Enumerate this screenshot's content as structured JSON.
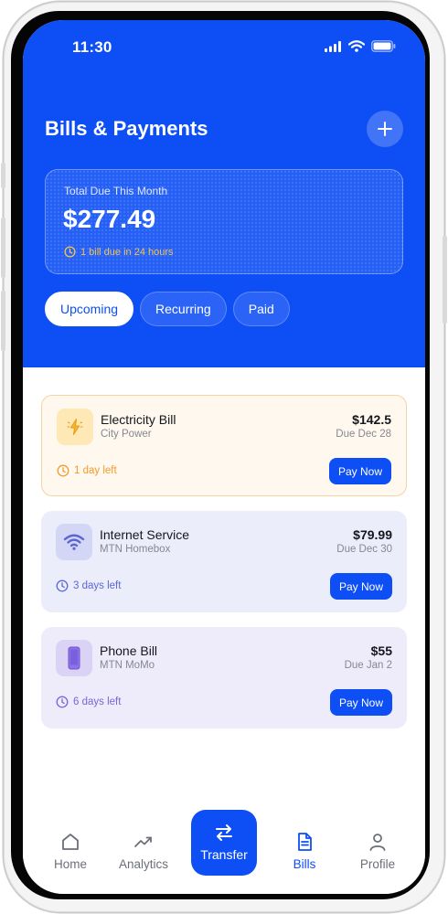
{
  "status_bar": {
    "time": "11:30"
  },
  "header": {
    "title": "Bills & Payments"
  },
  "summary": {
    "label": "Total Due This Month",
    "amount": "$277.49",
    "note": "1 bill due in 24 hours"
  },
  "tabs": [
    {
      "label": "Upcoming",
      "active": true
    },
    {
      "label": "Recurring",
      "active": false
    },
    {
      "label": "Paid",
      "active": false
    }
  ],
  "bills": [
    {
      "name": "Electricity Bill",
      "provider": "City Power",
      "amount": "$142.5",
      "due": "Due Dec 28",
      "days_left": "1 day left",
      "pay_label": "Pay Now",
      "icon": "lightning-icon"
    },
    {
      "name": "Internet Service",
      "provider": "MTN Homebox",
      "amount": "$79.99",
      "due": "Due Dec 30",
      "days_left": "3 days left",
      "pay_label": "Pay Now",
      "icon": "wifi-icon"
    },
    {
      "name": "Phone Bill",
      "provider": "MTN MoMo",
      "amount": "$55",
      "due": "Due Jan 2",
      "days_left": "6 days left",
      "pay_label": "Pay Now",
      "icon": "phone-icon"
    }
  ],
  "nav": {
    "home": "Home",
    "analytics": "Analytics",
    "transfer": "Transfer",
    "bills": "Bills",
    "profile": "Profile"
  },
  "colors": {
    "primary": "#0d4ef5",
    "warning": "#f29b2e",
    "due_note": "#f7c24a",
    "internet_accent": "#5b66d6",
    "phone_accent": "#7a63d9"
  }
}
